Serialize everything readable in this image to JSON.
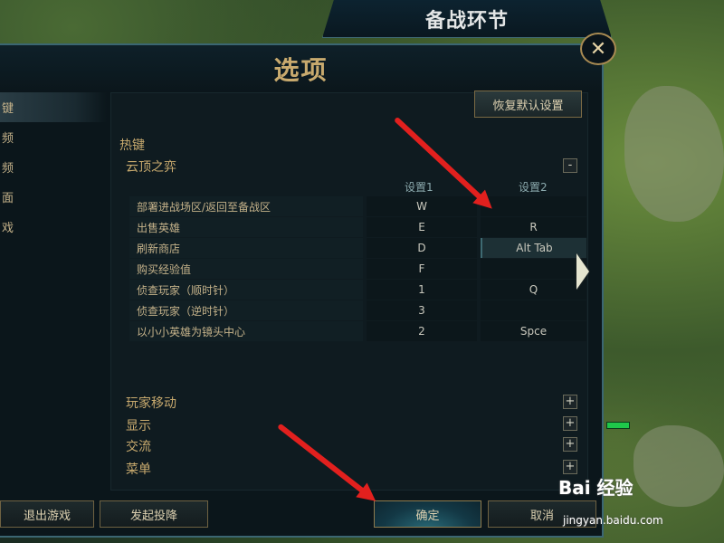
{
  "top_banner": {
    "title": "备战环节"
  },
  "window": {
    "title": "选项",
    "close_icon": "close-icon"
  },
  "sidebar": {
    "items": [
      {
        "label": "键",
        "active": true
      },
      {
        "label": "频",
        "active": false
      },
      {
        "label": "频",
        "active": false
      },
      {
        "label": "面",
        "active": false
      },
      {
        "label": "戏",
        "active": false
      }
    ]
  },
  "content": {
    "reset_label": "恢复默认设置",
    "section_title": "热键",
    "group_tft": {
      "label": "云顶之弈",
      "toggle": "-"
    },
    "columns": {
      "setting1": "设置1",
      "setting2": "设置2"
    },
    "rows": [
      {
        "label": "部署进战场区/返回至备战区",
        "key1": "W",
        "key2": ""
      },
      {
        "label": "出售英雄",
        "key1": "E",
        "key2": "R"
      },
      {
        "label": "刷新商店",
        "key1": "D",
        "key2": "Alt Tab"
      },
      {
        "label": "购买经验值",
        "key1": "F",
        "key2": ""
      },
      {
        "label": "侦查玩家（顺时针）",
        "key1": "1",
        "key2": "Q"
      },
      {
        "label": "侦查玩家（逆时针）",
        "key1": "3",
        "key2": ""
      },
      {
        "label": "以小小英雄为镜头中心",
        "key1": "2",
        "key2": "Spce"
      }
    ],
    "groups": [
      {
        "label": "玩家移动",
        "toggle": "+"
      },
      {
        "label": "显示",
        "toggle": "+"
      },
      {
        "label": "交流",
        "toggle": "+"
      },
      {
        "label": "菜单",
        "toggle": "+"
      }
    ]
  },
  "footer": {
    "quit_label": "退出游戏",
    "surrender_label": "发起投降",
    "ok_label": "确定",
    "cancel_label": "取消"
  },
  "watermark": {
    "brand": "Bai 经验",
    "url": "jingyan.baidu.com"
  },
  "colors": {
    "accent_gold": "#c8aa6e",
    "frame_teal": "#3b6672",
    "arrow_red": "#e2201e"
  }
}
